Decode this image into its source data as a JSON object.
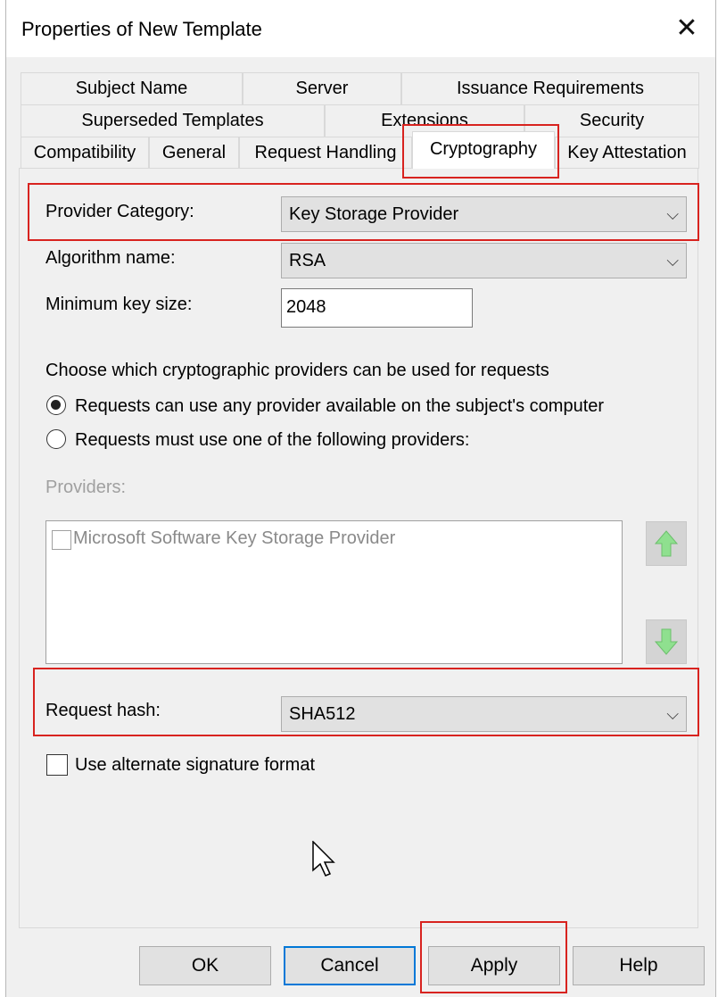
{
  "window": {
    "title": "Properties of New Template",
    "close_glyph": "✕"
  },
  "tabs": {
    "row1": [
      "Subject Name",
      "Server",
      "Issuance Requirements"
    ],
    "row2": [
      "Superseded Templates",
      "Extensions",
      "Security"
    ],
    "row3": [
      "Compatibility",
      "General",
      "Request Handling",
      "Cryptography",
      "Key Attestation"
    ],
    "active": "Cryptography"
  },
  "form": {
    "provider_category_label": "Provider Category:",
    "provider_category_value": "Key Storage Provider",
    "algorithm_label": "Algorithm name:",
    "algorithm_value": "RSA",
    "min_key_label": "Minimum key size:",
    "min_key_value": "2048",
    "providers_prompt": "Choose which cryptographic providers can be used for requests",
    "radio_any": "Requests can use any provider available on the subject's computer",
    "radio_specific": "Requests must use one of the following providers:",
    "radio_selected": "any",
    "providers_label": "Providers:",
    "providers_list": [
      "Microsoft Software Key Storage Provider"
    ],
    "request_hash_label": "Request hash:",
    "request_hash_value": "SHA512",
    "alt_signature_label": "Use alternate signature format",
    "alt_signature_checked": false
  },
  "buttons": {
    "ok": "OK",
    "cancel": "Cancel",
    "apply": "Apply",
    "help": "Help"
  },
  "colors": {
    "highlight": "#d8231f",
    "default_button_border": "#0078d7",
    "arrow_green": "#5cc85c"
  },
  "icons": {
    "combo_arrow": "chevron-down-icon",
    "move_up": "arrow-up-icon",
    "move_down": "arrow-down-icon",
    "cursor": "mouse-pointer-icon"
  }
}
